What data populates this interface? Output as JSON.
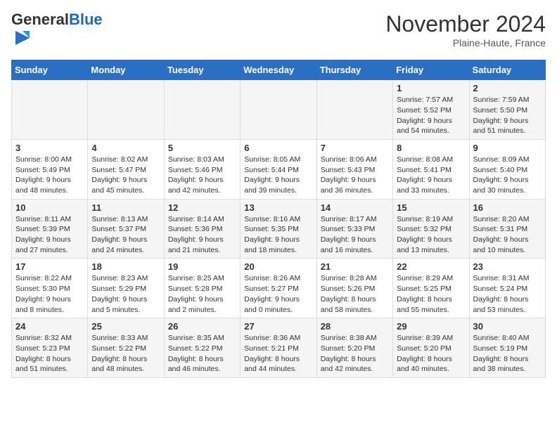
{
  "logo": {
    "general": "General",
    "blue": "Blue"
  },
  "title": "November 2024",
  "subtitle": "Plaine-Haute, France",
  "days_of_week": [
    "Sunday",
    "Monday",
    "Tuesday",
    "Wednesday",
    "Thursday",
    "Friday",
    "Saturday"
  ],
  "weeks": [
    [
      {
        "day": "",
        "info": ""
      },
      {
        "day": "",
        "info": ""
      },
      {
        "day": "",
        "info": ""
      },
      {
        "day": "",
        "info": ""
      },
      {
        "day": "",
        "info": ""
      },
      {
        "day": "1",
        "info": "Sunrise: 7:57 AM\nSunset: 5:52 PM\nDaylight: 9 hours and 54 minutes."
      },
      {
        "day": "2",
        "info": "Sunrise: 7:59 AM\nSunset: 5:50 PM\nDaylight: 9 hours and 51 minutes."
      }
    ],
    [
      {
        "day": "3",
        "info": "Sunrise: 8:00 AM\nSunset: 5:49 PM\nDaylight: 9 hours and 48 minutes."
      },
      {
        "day": "4",
        "info": "Sunrise: 8:02 AM\nSunset: 5:47 PM\nDaylight: 9 hours and 45 minutes."
      },
      {
        "day": "5",
        "info": "Sunrise: 8:03 AM\nSunset: 5:46 PM\nDaylight: 9 hours and 42 minutes."
      },
      {
        "day": "6",
        "info": "Sunrise: 8:05 AM\nSunset: 5:44 PM\nDaylight: 9 hours and 39 minutes."
      },
      {
        "day": "7",
        "info": "Sunrise: 8:06 AM\nSunset: 5:43 PM\nDaylight: 9 hours and 36 minutes."
      },
      {
        "day": "8",
        "info": "Sunrise: 8:08 AM\nSunset: 5:41 PM\nDaylight: 9 hours and 33 minutes."
      },
      {
        "day": "9",
        "info": "Sunrise: 8:09 AM\nSunset: 5:40 PM\nDaylight: 9 hours and 30 minutes."
      }
    ],
    [
      {
        "day": "10",
        "info": "Sunrise: 8:11 AM\nSunset: 5:39 PM\nDaylight: 9 hours and 27 minutes."
      },
      {
        "day": "11",
        "info": "Sunrise: 8:13 AM\nSunset: 5:37 PM\nDaylight: 9 hours and 24 minutes."
      },
      {
        "day": "12",
        "info": "Sunrise: 8:14 AM\nSunset: 5:36 PM\nDaylight: 9 hours and 21 minutes."
      },
      {
        "day": "13",
        "info": "Sunrise: 8:16 AM\nSunset: 5:35 PM\nDaylight: 9 hours and 18 minutes."
      },
      {
        "day": "14",
        "info": "Sunrise: 8:17 AM\nSunset: 5:33 PM\nDaylight: 9 hours and 16 minutes."
      },
      {
        "day": "15",
        "info": "Sunrise: 8:19 AM\nSunset: 5:32 PM\nDaylight: 9 hours and 13 minutes."
      },
      {
        "day": "16",
        "info": "Sunrise: 8:20 AM\nSunset: 5:31 PM\nDaylight: 9 hours and 10 minutes."
      }
    ],
    [
      {
        "day": "17",
        "info": "Sunrise: 8:22 AM\nSunset: 5:30 PM\nDaylight: 9 hours and 8 minutes."
      },
      {
        "day": "18",
        "info": "Sunrise: 8:23 AM\nSunset: 5:29 PM\nDaylight: 9 hours and 5 minutes."
      },
      {
        "day": "19",
        "info": "Sunrise: 8:25 AM\nSunset: 5:28 PM\nDaylight: 9 hours and 2 minutes."
      },
      {
        "day": "20",
        "info": "Sunrise: 8:26 AM\nSunset: 5:27 PM\nDaylight: 9 hours and 0 minutes."
      },
      {
        "day": "21",
        "info": "Sunrise: 8:28 AM\nSunset: 5:26 PM\nDaylight: 8 hours and 58 minutes."
      },
      {
        "day": "22",
        "info": "Sunrise: 8:29 AM\nSunset: 5:25 PM\nDaylight: 8 hours and 55 minutes."
      },
      {
        "day": "23",
        "info": "Sunrise: 8:31 AM\nSunset: 5:24 PM\nDaylight: 8 hours and 53 minutes."
      }
    ],
    [
      {
        "day": "24",
        "info": "Sunrise: 8:32 AM\nSunset: 5:23 PM\nDaylight: 8 hours and 51 minutes."
      },
      {
        "day": "25",
        "info": "Sunrise: 8:33 AM\nSunset: 5:22 PM\nDaylight: 8 hours and 48 minutes."
      },
      {
        "day": "26",
        "info": "Sunrise: 8:35 AM\nSunset: 5:22 PM\nDaylight: 8 hours and 46 minutes."
      },
      {
        "day": "27",
        "info": "Sunrise: 8:36 AM\nSunset: 5:21 PM\nDaylight: 8 hours and 44 minutes."
      },
      {
        "day": "28",
        "info": "Sunrise: 8:38 AM\nSunset: 5:20 PM\nDaylight: 8 hours and 42 minutes."
      },
      {
        "day": "29",
        "info": "Sunrise: 8:39 AM\nSunset: 5:20 PM\nDaylight: 8 hours and 40 minutes."
      },
      {
        "day": "30",
        "info": "Sunrise: 8:40 AM\nSunset: 5:19 PM\nDaylight: 8 hours and 38 minutes."
      }
    ]
  ]
}
